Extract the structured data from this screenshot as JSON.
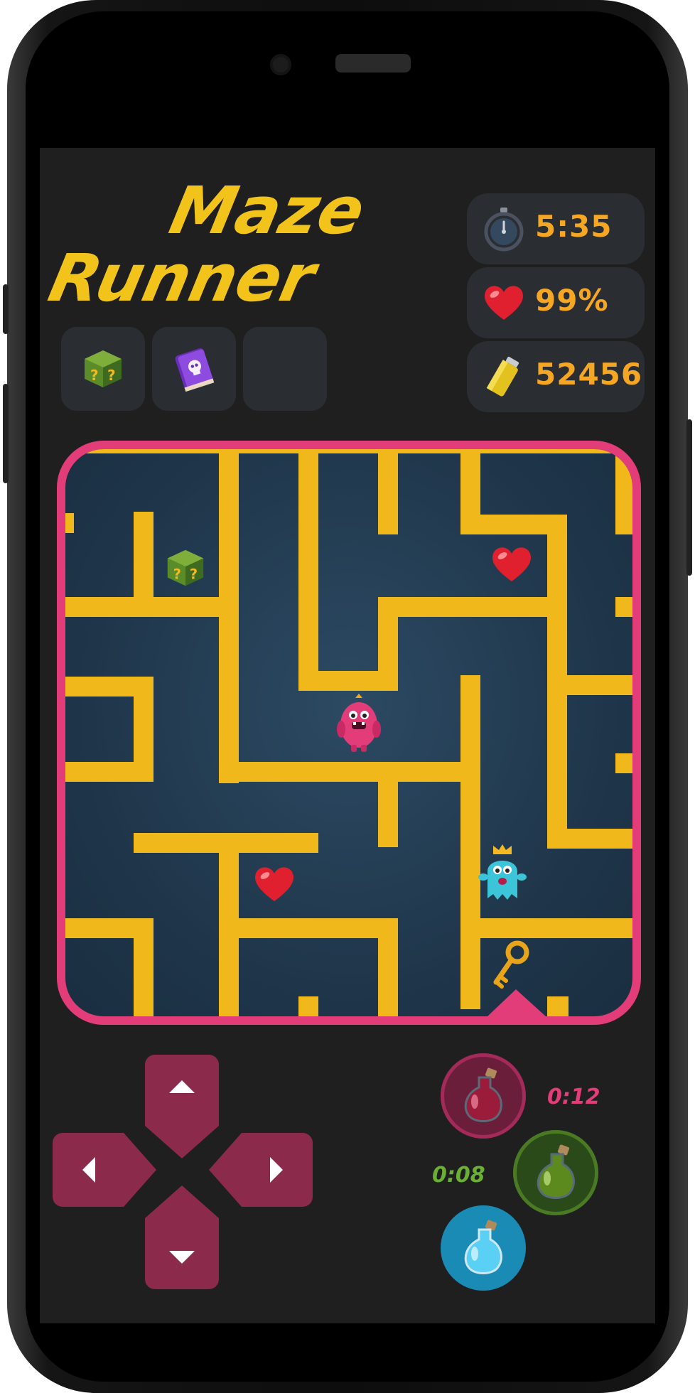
{
  "game": {
    "logo_line1": "Maze",
    "logo_line2": "Runner"
  },
  "inventory": {
    "slots": [
      {
        "item": "mystery-box-icon"
      },
      {
        "item": "spell-book-icon"
      },
      {
        "item": ""
      }
    ]
  },
  "stats": {
    "time": "5:35",
    "health": "99%",
    "score": "52456",
    "time_icon": "stopwatch-icon",
    "health_icon": "heart-icon",
    "score_icon": "battery-icon"
  },
  "maze": {
    "items": [
      "mystery-box-icon",
      "heart-icon",
      "heart-icon",
      "pink-monster-player",
      "blue-ghost-crowned-enemy",
      "golden-key-icon",
      "exit-marker"
    ]
  },
  "controls": {
    "dpad": [
      "up",
      "left",
      "right",
      "down"
    ]
  },
  "potions": {
    "red": {
      "timer": "0:12"
    },
    "green": {
      "timer": "0:08"
    },
    "blue": {
      "timer": ""
    }
  },
  "colors": {
    "accent": "#e23d78",
    "wall": "#f0b81a",
    "stat_text": "#f5a623",
    "dpad": "#8c2a4c",
    "timer_red": "#e23d78",
    "timer_green": "#6ab032"
  }
}
